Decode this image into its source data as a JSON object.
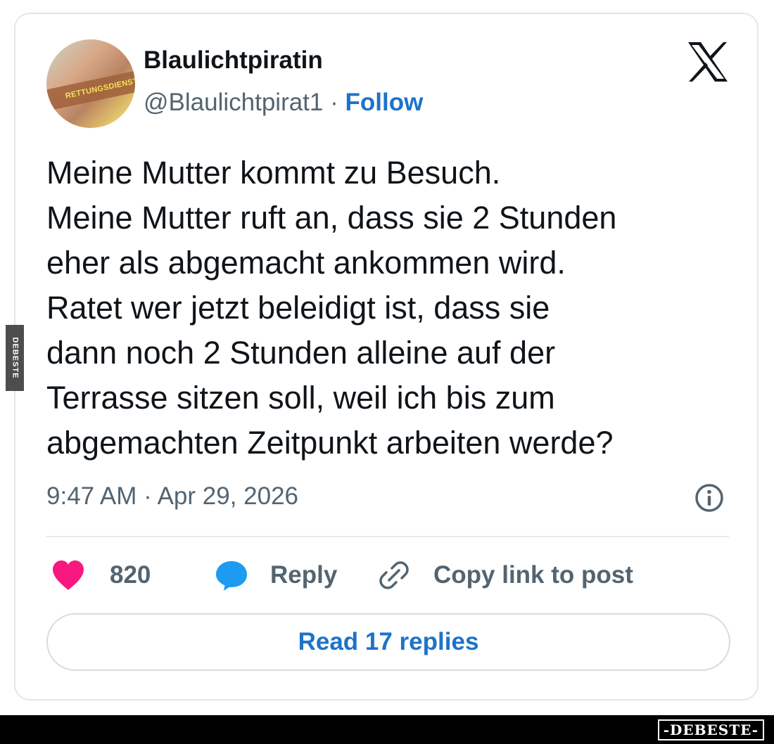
{
  "author": {
    "display_name": "Blaulichtpiratin",
    "handle": "@Blaulichtpirat1",
    "separator": " · ",
    "follow_label": "Follow",
    "avatar_badge_text": "RETTUNGSDIENST"
  },
  "tweet": {
    "text": "Meine Mutter kommt zu Besuch.\nMeine Mutter ruft an, dass sie 2 Stunden\neher als abgemacht ankommen wird.\nRatet wer jetzt beleidigt ist, dass sie\ndann noch 2 Stunden alleine auf der\nTerrasse sitzen soll, weil ich bis zum\nabgemachten Zeitpunkt arbeiten werde?",
    "timestamp": "9:47 AM · Apr 29, 2026"
  },
  "actions": {
    "likes_count": "820",
    "reply_label": "Reply",
    "copy_link_label": "Copy link to post"
  },
  "read_replies_label": "Read 17 replies",
  "watermark": {
    "side_text": "DEBESTE",
    "footer_text": "-DEBESTE-"
  },
  "colors": {
    "accent_blue": "#1d73c9",
    "like_pink": "#f91880",
    "reply_blue": "#1d9bf0",
    "text_primary": "#0f1419",
    "text_secondary": "#536471"
  },
  "icons": [
    "x-logo-icon",
    "info-icon",
    "heart-icon",
    "reply-bubble-icon",
    "link-icon"
  ]
}
